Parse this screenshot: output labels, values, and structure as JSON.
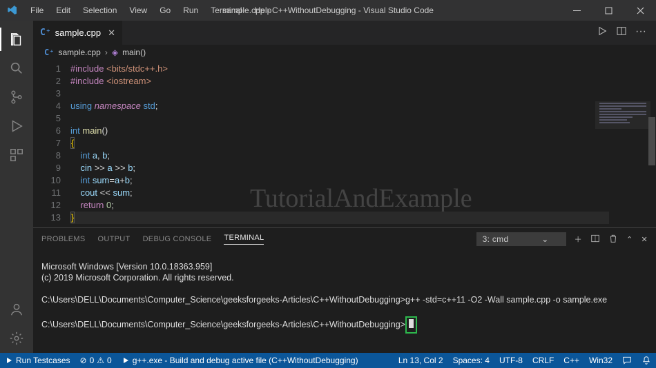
{
  "titlebar": {
    "title": "sample.cpp - C++WithoutDebugging - Visual Studio Code"
  },
  "menu": {
    "file": "File",
    "edit": "Edit",
    "selection": "Selection",
    "view": "View",
    "go": "Go",
    "run": "Run",
    "terminal": "Terminal",
    "help": "Help"
  },
  "tab": {
    "filename": "sample.cpp",
    "icon": "C⁺"
  },
  "breadcrumb": {
    "file": "sample.cpp",
    "symbol": "main()"
  },
  "code": {
    "lines": [
      "1",
      "2",
      "3",
      "4",
      "5",
      "6",
      "7",
      "8",
      "9",
      "10",
      "11",
      "12",
      "13"
    ],
    "l1a": "#include",
    "l1b": "<bits/stdc++.h>",
    "l2a": "#include",
    "l2b": "<iostream>",
    "l4a": "using",
    "l4b": "namespace",
    "l4c": "std",
    "l4d": ";",
    "l6a": "int",
    "l6b": "main",
    "l6c": "()",
    "l7a": "{",
    "l8a": "int",
    "l8b": "a",
    "l8c": ",",
    "l8d": "b",
    "l8e": ";",
    "l9a": "cin",
    "l9b": ">>",
    "l9c": "a",
    "l9d": ">>",
    "l9e": "b",
    "l9f": ";",
    "l10a": "int",
    "l10b": "sum",
    "l10c": "=",
    "l10d": "a",
    "l10e": "+",
    "l10f": "b",
    "l10g": ";",
    "l11a": "cout",
    "l11b": "<<",
    "l11c": "sum",
    "l11d": ";",
    "l12a": "return",
    "l12b": "0",
    "l12c": ";",
    "l13a": "}"
  },
  "watermark": "TutorialAndExample",
  "panel": {
    "tabs": {
      "problems": "Problems",
      "output": "Output",
      "debug": "Debug Console",
      "terminal": "Terminal"
    },
    "selector": "3: cmd"
  },
  "terminal": {
    "line1": "Microsoft Windows [Version 10.0.18363.959]",
    "line2": "(c) 2019 Microsoft Corporation. All rights reserved.",
    "line3": "C:\\Users\\DELL\\Documents\\Computer_Science\\geeksforgeeks-Articles\\C++WithoutDebugging>g++ -std=c++11 -O2 -Wall sample.cpp -o sample.exe",
    "line4": "C:\\Users\\DELL\\Documents\\Computer_Science\\geeksforgeeks-Articles\\C++WithoutDebugging>"
  },
  "status": {
    "run": "Run Testcases",
    "errors": "0",
    "warnings": "0",
    "build": "g++.exe - Build and debug active file (C++WithoutDebugging)",
    "lncol": "Ln 13, Col 2",
    "spaces": "Spaces: 4",
    "encoding": "UTF-8",
    "eol": "CRLF",
    "lang": "C++",
    "target": "Win32"
  }
}
